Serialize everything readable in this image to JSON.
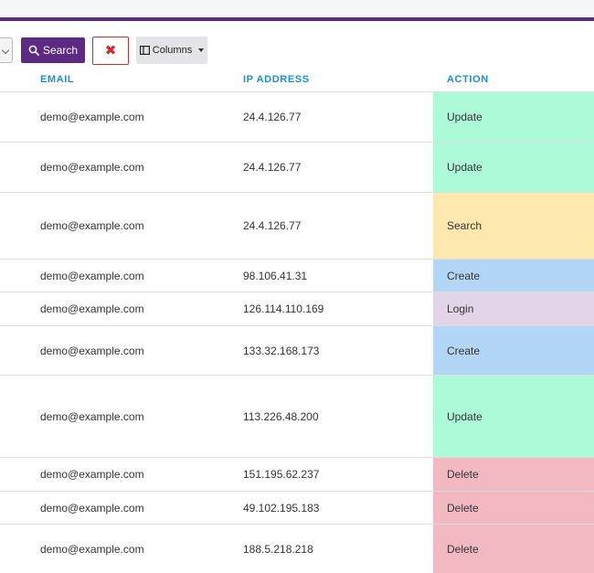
{
  "toolbar": {
    "search_label": "Search",
    "clear_symbol": "✖",
    "columns_label": "Columns",
    "icons": {
      "search": "search-icon",
      "clear": "close-icon",
      "columns": "columns-icon",
      "caret": "caret-down-icon"
    },
    "colors": {
      "primary": "#5b2b83",
      "danger": "#d9232e"
    }
  },
  "table": {
    "headers": {
      "email": "EMAIL",
      "ip": "IP ADDRESS",
      "action": "ACTION"
    },
    "action_colors": {
      "Update": "#acfad7",
      "Search": "#fde8ae",
      "Create": "#b3d6f6",
      "Login": "#e2d5ea",
      "Delete": "#f3b9c3"
    },
    "rows": [
      {
        "email": "demo@example.com",
        "ip": "24.4.126.77",
        "action": "Update"
      },
      {
        "email": "demo@example.com",
        "ip": "24.4.126.77",
        "action": "Update"
      },
      {
        "email": "demo@example.com",
        "ip": "24.4.126.77",
        "action": "Search"
      },
      {
        "email": "demo@example.com",
        "ip": "98.106.41.31",
        "action": "Create"
      },
      {
        "email": "demo@example.com",
        "ip": "126.114.110.169",
        "action": "Login"
      },
      {
        "email": "demo@example.com",
        "ip": "133.32.168.173",
        "action": "Create"
      },
      {
        "email": "demo@example.com",
        "ip": "113.226.48.200",
        "action": "Update"
      },
      {
        "email": "demo@example.com",
        "ip": "151.195.62.237",
        "action": "Delete"
      },
      {
        "email": "demo@example.com",
        "ip": "49.102.195.183",
        "action": "Delete"
      },
      {
        "email": "demo@example.com",
        "ip": "188.5.218.218",
        "action": "Delete"
      }
    ]
  }
}
